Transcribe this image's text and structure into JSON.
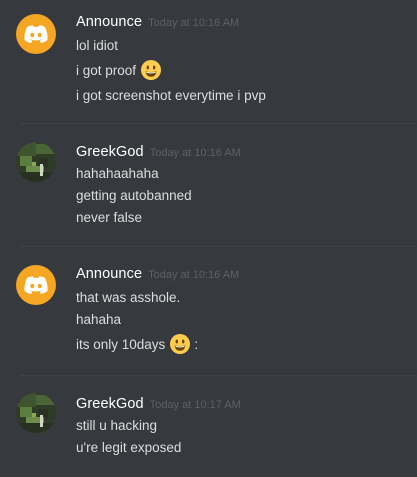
{
  "messages": [
    {
      "username": "Announce",
      "timestamp": "Today at 10:16 AM",
      "avatar": "discord-logo-icon",
      "lines": [
        {
          "text": "lol idiot"
        },
        {
          "text": "i got proof",
          "emoji": "grinning-emoji"
        },
        {
          "text": "i got screenshot everytime i pvp"
        }
      ]
    },
    {
      "username": "GreekGod",
      "timestamp": "Today at 10:16 AM",
      "avatar": "minecraft-avatar",
      "lines": [
        {
          "text": "hahahaahaha"
        },
        {
          "text": "getting autobanned"
        },
        {
          "text": "never false"
        }
      ]
    },
    {
      "username": "Announce",
      "timestamp": "Today at 10:16 AM",
      "avatar": "discord-logo-icon",
      "lines": [
        {
          "text": "that was asshole."
        },
        {
          "text": "hahaha"
        },
        {
          "text": "its only 10days",
          "emoji": "grinning-emoji",
          "suffix": ":"
        }
      ]
    },
    {
      "username": "GreekGod",
      "timestamp": "Today at 10:17 AM",
      "avatar": "minecraft-avatar",
      "lines": [
        {
          "text": "still u hacking"
        },
        {
          "text": "u're legit exposed"
        }
      ]
    }
  ],
  "colors": {
    "background": "#36393e",
    "username": "#ffffff",
    "timestamp": "#5d6166",
    "message_text": "#dcddde",
    "discord_avatar": "#f5a623",
    "emoji_face": "#ffcc4d"
  }
}
